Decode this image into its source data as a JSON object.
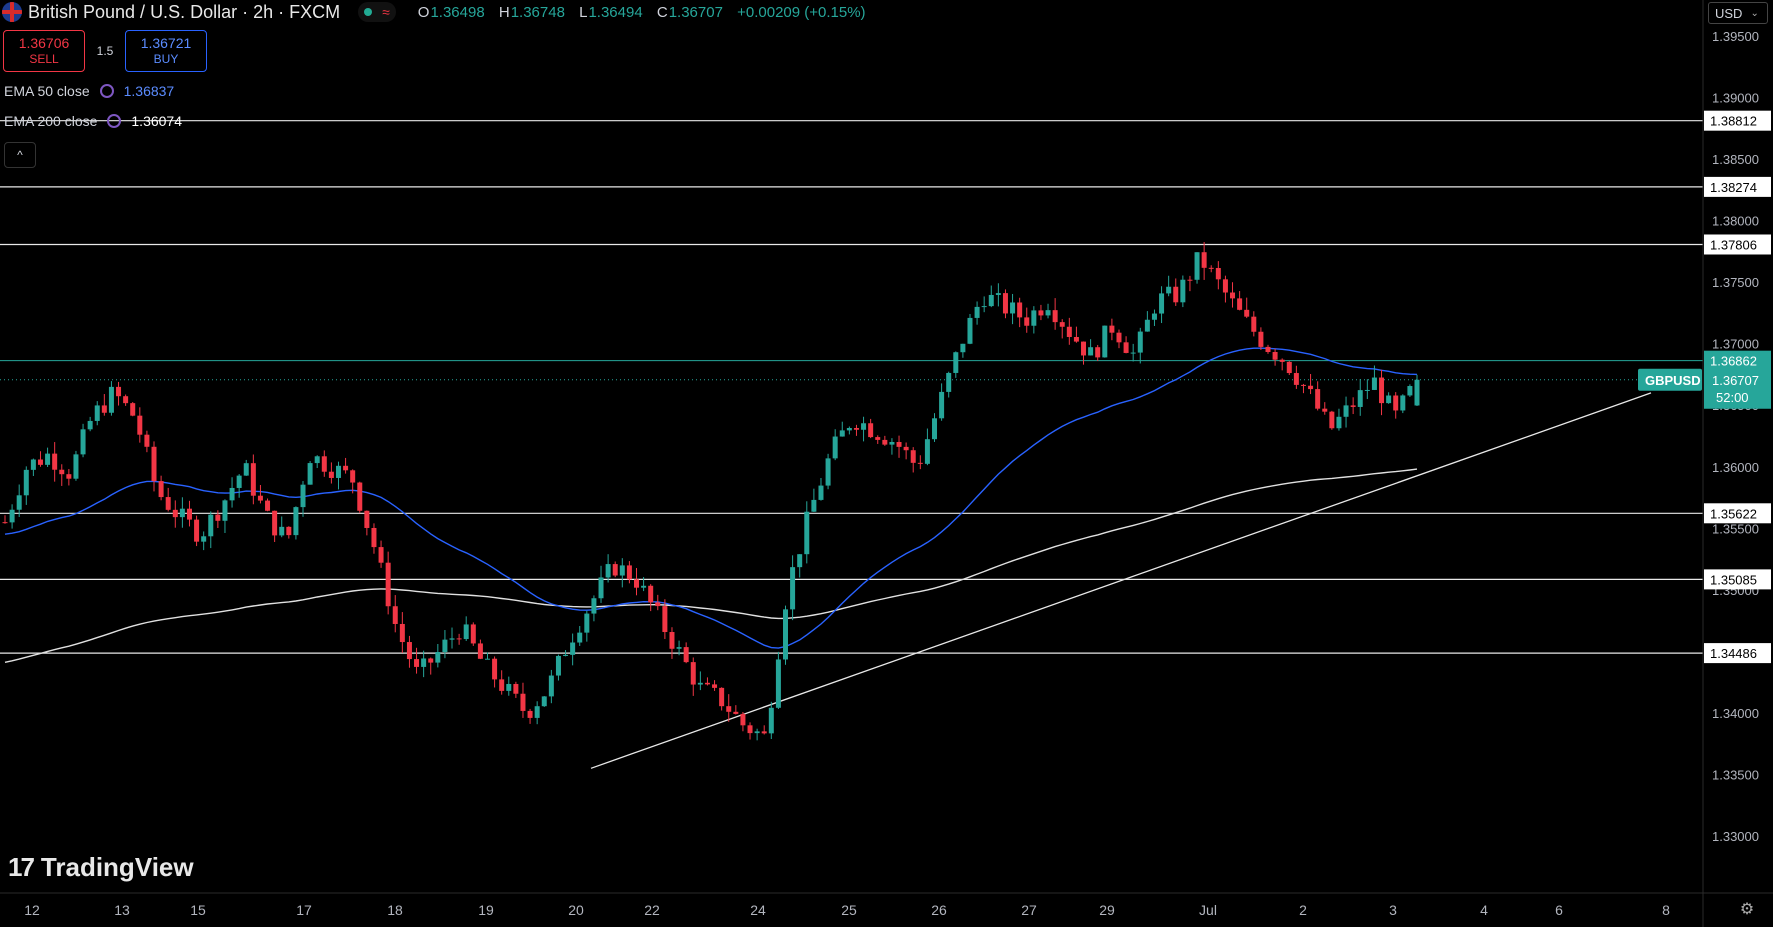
{
  "header": {
    "title": "British Pound / U.S. Dollar · 2h · FXCM",
    "ohlc": {
      "o_label": "O",
      "o": "1.36498",
      "h_label": "H",
      "h": "1.36748",
      "l_label": "L",
      "l": "1.36494",
      "c_label": "C",
      "c": "1.36707",
      "change": "+0.00209 (+0.15%)"
    },
    "status_icon": "market-open-dot",
    "wave_icon": "≈"
  },
  "trade": {
    "sell_price": "1.36706",
    "sell_label": "SELL",
    "spread": "1.5",
    "buy_price": "1.36721",
    "buy_label": "BUY"
  },
  "indicators": [
    {
      "name": "EMA 50 close",
      "value": "1.36837",
      "color": "#2962ff"
    },
    {
      "name": "EMA 200 close",
      "value": "1.36074",
      "color": "#e0e0e0"
    }
  ],
  "collapse_icon": "^",
  "currency_select": "USD",
  "logo": {
    "mark": "17",
    "text": "TradingView"
  },
  "settings_icon": "gear-icon",
  "colors": {
    "up": "#26a69a",
    "down": "#f23645",
    "ema50": "#2962ff",
    "ema200": "#e0e0e0",
    "price_tag": "#26a69a"
  },
  "chart_data": {
    "type": "candlestick",
    "symbol": "GBPUSD",
    "timeframe": "2h",
    "ylim": [
      1.3255,
      1.397
    ],
    "y_ticks": [
      "1.39500",
      "1.39000",
      "1.38500",
      "1.38000",
      "1.37500",
      "1.37000",
      "1.36500",
      "1.36000",
      "1.35500",
      "1.35000",
      "1.34500",
      "1.34000",
      "1.33500",
      "1.33000"
    ],
    "x_ticks": [
      "12",
      "13",
      "15",
      "17",
      "18",
      "19",
      "20",
      "22",
      "24",
      "25",
      "26",
      "27",
      "29",
      "Jul",
      "2",
      "3",
      "4",
      "6",
      "8"
    ],
    "horizontal_levels": [
      {
        "value": 1.38812,
        "label": "1.38812"
      },
      {
        "value": 1.38274,
        "label": "1.38274"
      },
      {
        "value": 1.37806,
        "label": "1.37806"
      },
      {
        "value": 1.35622,
        "label": "1.35622"
      },
      {
        "value": 1.35085,
        "label": "1.35085"
      },
      {
        "value": 1.34486,
        "label": "1.34486"
      }
    ],
    "ema50_tag": {
      "value": 1.36862,
      "label": "1.36862"
    },
    "current_price": {
      "value": 1.36707,
      "label": "1.36707",
      "symbol": "GBPUSD",
      "countdown": "52:00"
    },
    "trendline": {
      "from": {
        "x_tick": "20",
        "price": 1.3355
      },
      "to": {
        "x_tick": "4",
        "price": 1.367
      }
    },
    "candles_close_path": [
      1.3555,
      1.36,
      1.361,
      1.3595,
      1.364,
      1.366,
      1.364,
      1.358,
      1.356,
      1.3545,
      1.357,
      1.36,
      1.356,
      1.354,
      1.361,
      1.36,
      1.359,
      1.3535,
      1.347,
      1.343,
      1.345,
      1.347,
      1.344,
      1.342,
      1.34,
      1.342,
      1.346,
      1.349,
      1.352,
      1.351,
      1.348,
      1.345,
      1.342,
      1.341,
      1.339,
      1.338,
      1.35,
      1.356,
      1.361,
      1.364,
      1.363,
      1.362,
      1.36,
      1.365,
      1.37,
      1.374,
      1.373,
      1.372,
      1.3735,
      1.371,
      1.369,
      1.3715,
      1.369,
      1.3735,
      1.374,
      1.377,
      1.3745,
      1.372,
      1.37,
      1.3685,
      1.366,
      1.363,
      1.365,
      1.367,
      1.364,
      1.367
    ]
  }
}
